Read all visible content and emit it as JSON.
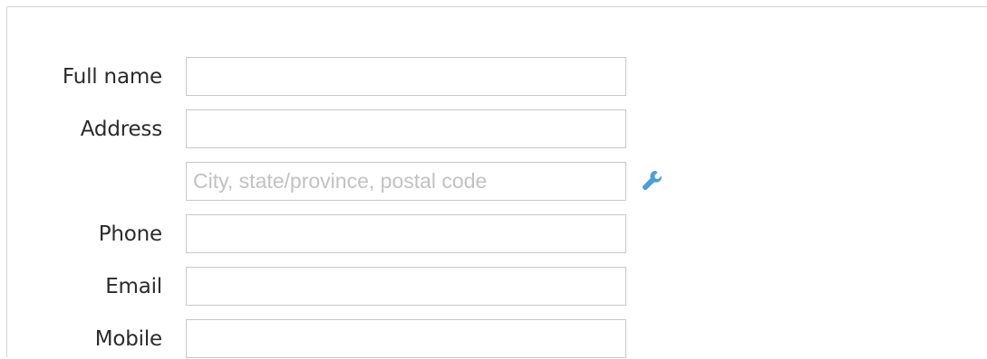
{
  "form": {
    "full_name": {
      "label": "Full name",
      "value": "",
      "placeholder": ""
    },
    "address": {
      "label": "Address",
      "value": "",
      "placeholder": ""
    },
    "address_line2": {
      "value": "",
      "placeholder": "City, state/province, postal code"
    },
    "phone": {
      "label": "Phone",
      "value": "",
      "placeholder": ""
    },
    "email": {
      "label": "Email",
      "value": "",
      "placeholder": ""
    },
    "mobile": {
      "label": "Mobile",
      "value": "",
      "placeholder": ""
    }
  },
  "icons": {
    "address_tool": "wrench-icon",
    "accent_color": "#4a9fd8"
  }
}
